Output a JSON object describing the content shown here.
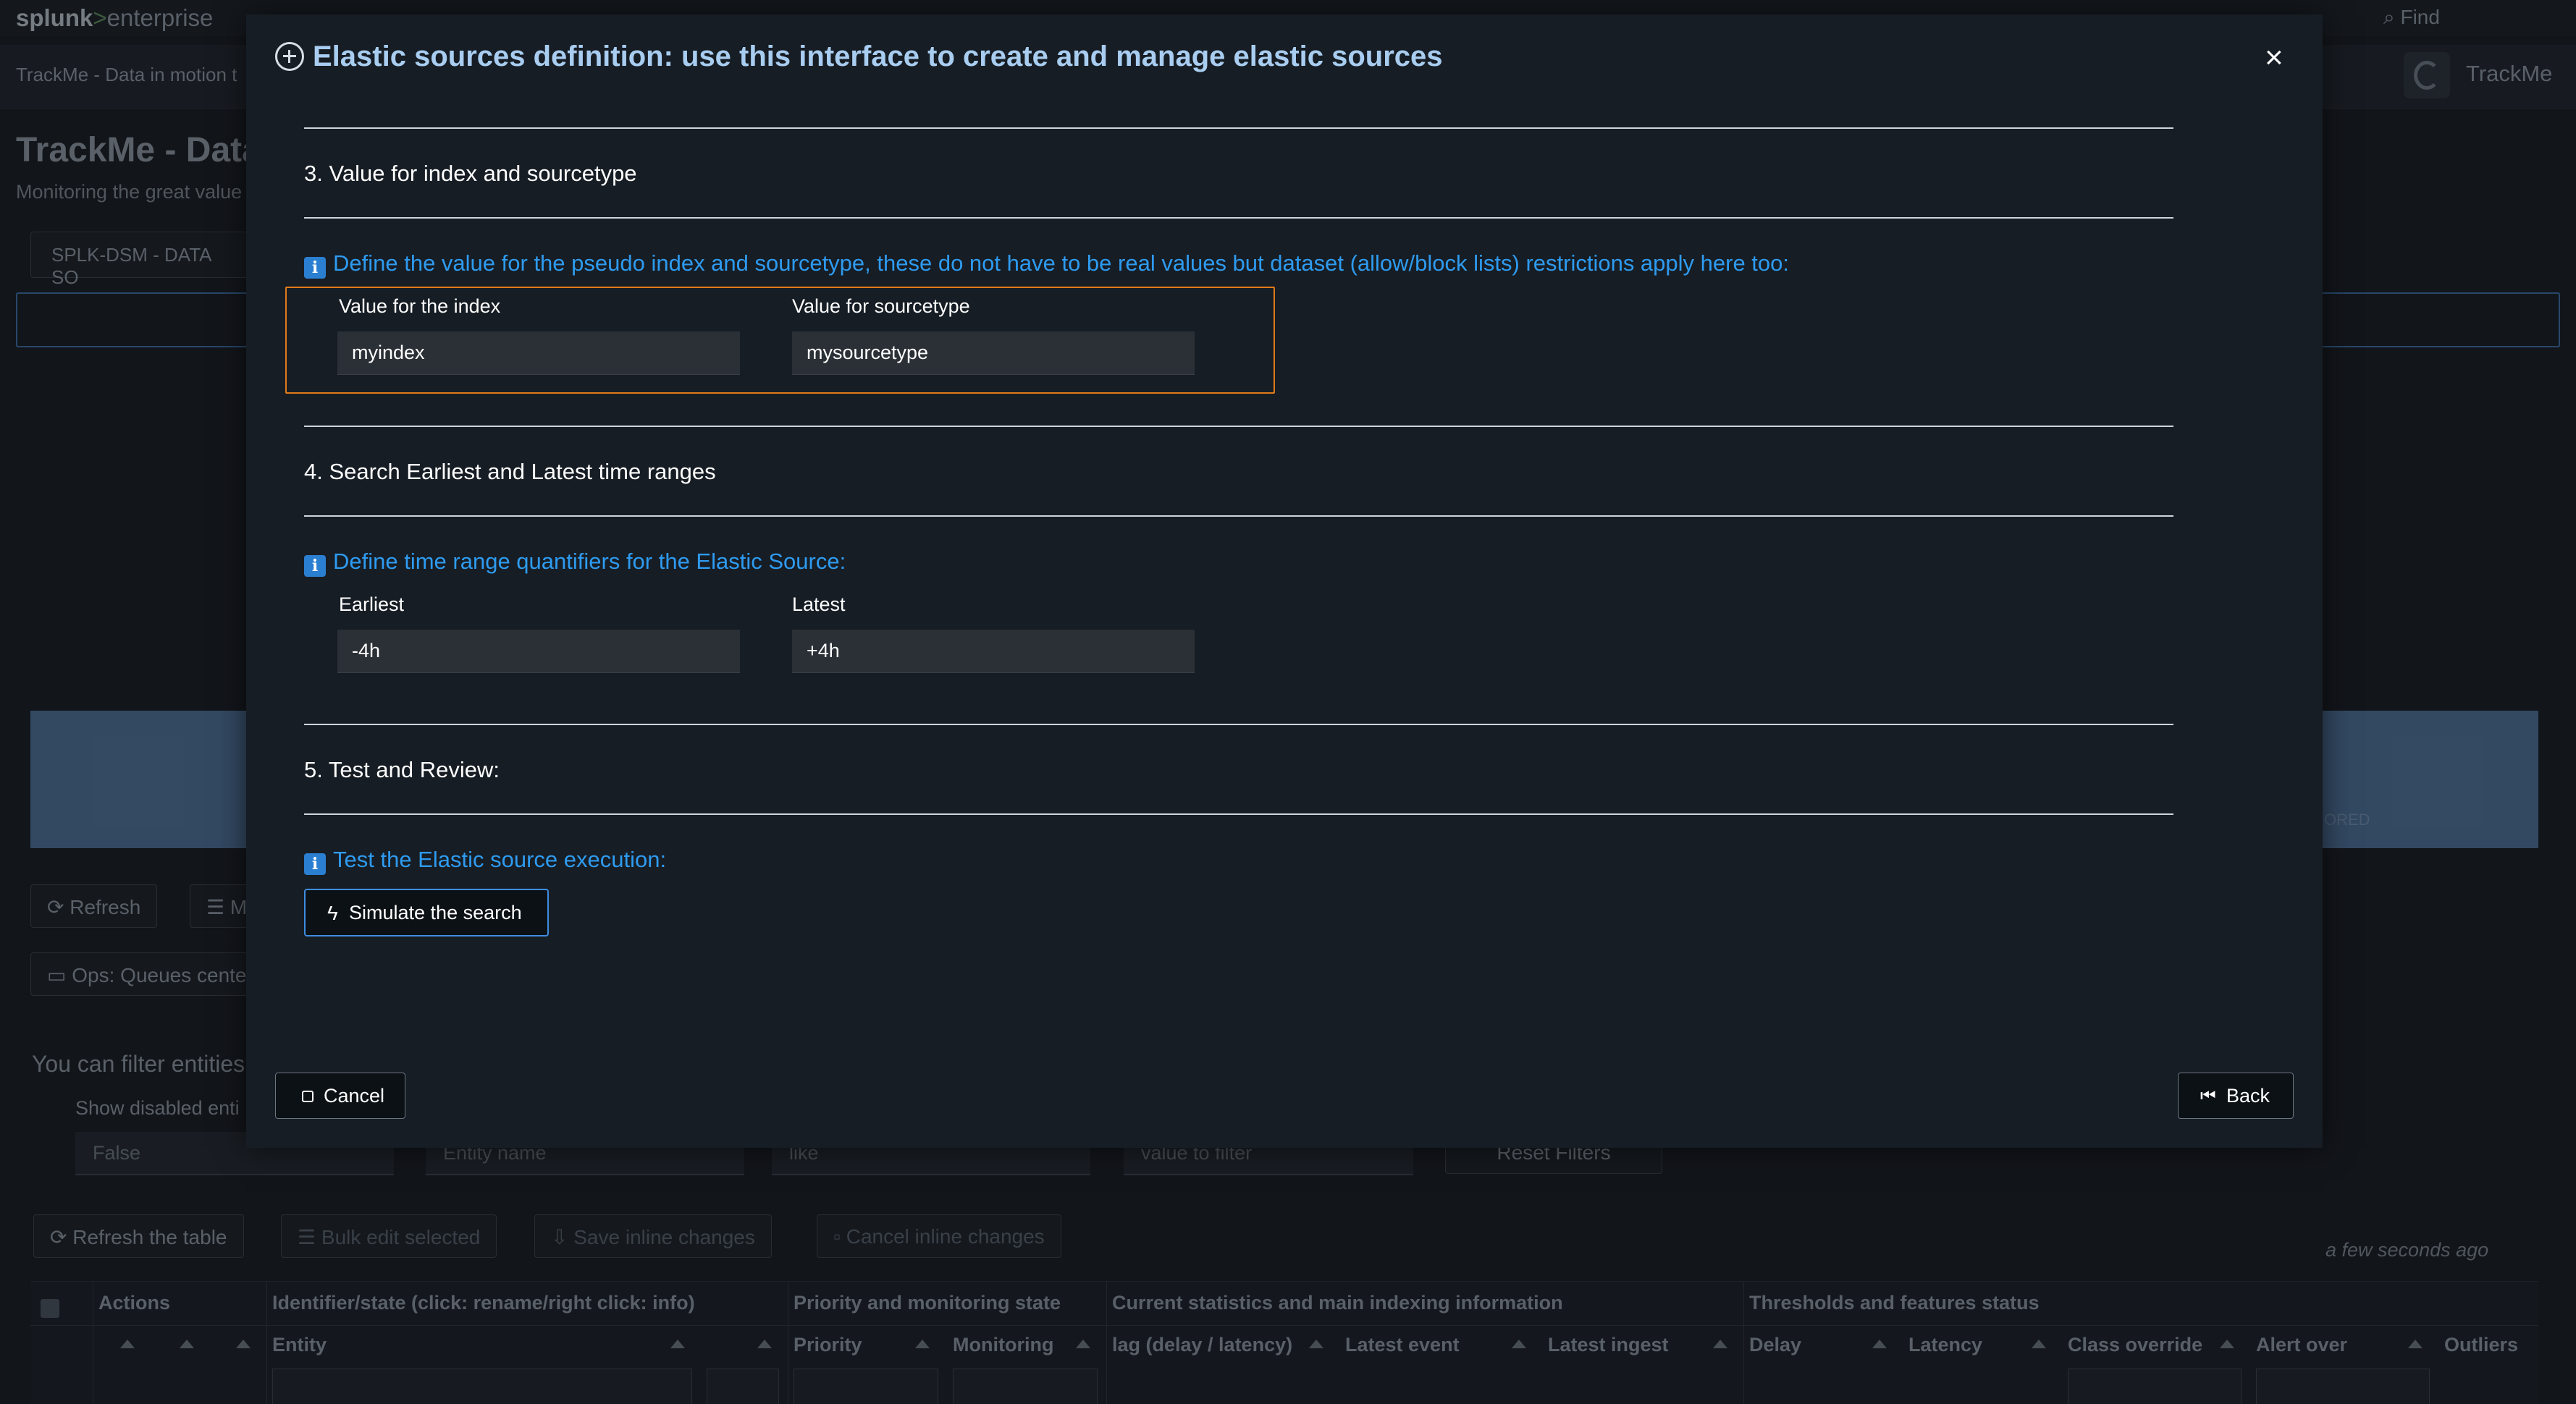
{
  "topbar": {
    "brand_part1": "splunk",
    "brand_part2": ">",
    "brand_part3": "enterprise",
    "find_placeholder": "Find"
  },
  "app": {
    "nav_label": "TrackMe - Data in motion t",
    "logo_name": "TrackMe",
    "page_title": "TrackMe - Data",
    "page_subtitle": "Monitoring the great value",
    "dashboard_button": "SPLK-DSM - DATA SO",
    "refresh_button": "Refresh",
    "manage_button": "M",
    "ops_button": "Ops: Queues cente",
    "filter_text": "You can filter entities",
    "show_disabled_label": "Show disabled enti",
    "filters": {
      "disabled_value": "False",
      "entity_placeholder": "Entity name",
      "operator_value": "like",
      "value_placeholder": "value to filter",
      "reset_button": "Reset Filters"
    },
    "table_actions": {
      "refresh": "Refresh the table",
      "bulk_edit": "Bulk edit selected",
      "save_inline": "Save inline changes",
      "cancel_inline": "Cancel inline changes"
    },
    "last_refresh": "a few seconds ago",
    "table_groups": {
      "actions": "Actions",
      "identifier": "Identifier/state (click: rename/right click: info)",
      "priority": "Priority and monitoring state",
      "statistics": "Current statistics and main indexing information",
      "thresholds": "Thresholds and features status"
    },
    "table_columns": {
      "entity": "Entity",
      "priority": "Priority",
      "monitoring": "Monitoring",
      "lag": "lag (delay / latency)",
      "latest_event": "Latest event",
      "latest_ingest": "Latest ingest",
      "delay": "Delay",
      "latency": "Latency",
      "class_override": "Class override",
      "alert_over": "Alert over",
      "outliers": "Outliers"
    },
    "banner_ghost_text": "ORED"
  },
  "modal": {
    "title": "Elastic sources definition: use this interface to create and manage elastic sources",
    "close_symbol": "×",
    "section3": {
      "title": "3. Value for index and sourcetype",
      "info": "Define the value for the pseudo index and sourcetype, these do not have to be real values but dataset (allow/block lists) restrictions apply here too:",
      "index_label": "Value for the index",
      "index_value": "myindex",
      "sourcetype_label": "Value for sourcetype",
      "sourcetype_value": "mysourcetype"
    },
    "section4": {
      "title": "4. Search Earliest and Latest time ranges",
      "info": "Define time range quantifiers for the Elastic Source:",
      "earliest_label": "Earliest",
      "earliest_value": "-4h",
      "latest_label": "Latest",
      "latest_value": "+4h"
    },
    "section5": {
      "title": "5. Test and Review:",
      "info": "Test the Elastic source execution:",
      "simulate_button": "Simulate the search"
    },
    "info_icon_glyph": "i",
    "cancel_button": "Cancel",
    "back_button": "Back"
  },
  "colors": {
    "title_blue": "#a8cdf0",
    "info_blue": "#2e9bf0",
    "highlight_orange": "#e07a1a",
    "modal_bg": "#171d24"
  }
}
